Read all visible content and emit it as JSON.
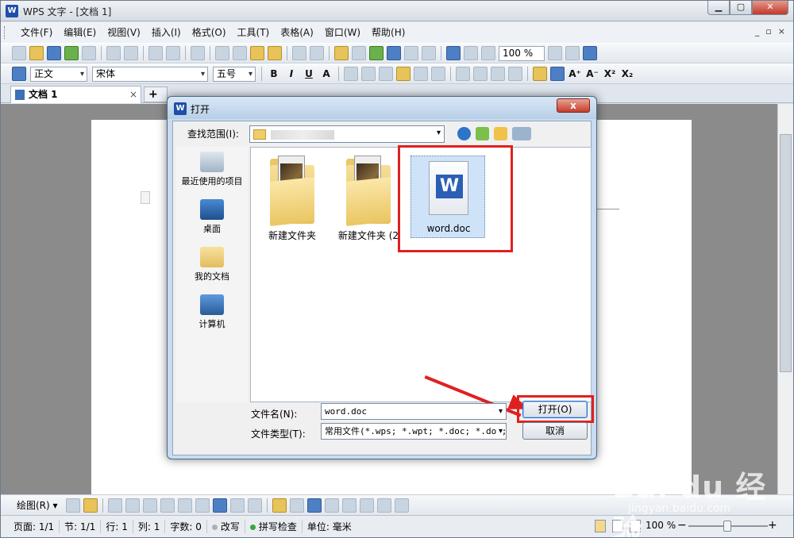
{
  "window": {
    "title": "WPS 文字 - [文档 1]",
    "app_icon": "W",
    "min_label": "▁",
    "max_label": "▢",
    "close_label": "✕"
  },
  "menubar": {
    "items": [
      "文件(F)",
      "编辑(E)",
      "视图(V)",
      "插入(I)",
      "格式(O)",
      "工具(T)",
      "表格(A)",
      "窗口(W)",
      "帮助(H)"
    ],
    "mdi": [
      "_",
      "▫",
      "×"
    ]
  },
  "toolbar": {
    "zoom": "100 %"
  },
  "format_bar": {
    "style": "正文",
    "font": "宋体",
    "size": "五号",
    "bold": "B",
    "italic": "I",
    "underline": "U",
    "font_a": "A",
    "superscript": "X²",
    "subscript": "X₂"
  },
  "tabs": {
    "doc_tab": "文档 1",
    "close": "×",
    "new": "+ ▾"
  },
  "dialog": {
    "title": "打开",
    "close_label": "x",
    "lookin_label": "查找范围(I):",
    "places": [
      "最近使用的项目",
      "桌面",
      "我的文档",
      "计算机"
    ],
    "files": [
      {
        "name": "新建文件夹",
        "type": "folder"
      },
      {
        "name": "新建文件夹 (2",
        "type": "folder"
      },
      {
        "name": "word.doc",
        "type": "doc"
      }
    ],
    "filename_label": "文件名(N):",
    "filename_value": "word.doc",
    "filetype_label": "文件类型(T):",
    "filetype_value": "常用文件(*.wps; *.wpt; *.doc; *.dot;",
    "open_button": "打开(O)",
    "cancel_button": "取消"
  },
  "drawbar": {
    "label": "绘图(R) ▾"
  },
  "status": {
    "page": "页面: 1/1",
    "section": "节: 1/1",
    "row": "行: 1",
    "col": "列: 1",
    "chars": "字数: 0",
    "overwrite": "改写",
    "spellcheck": "拼写检查",
    "unit": "单位: 毫米",
    "zoom": "100 %",
    "minus": "−",
    "plus": "+"
  },
  "watermark": {
    "brand": "Bai du 经验",
    "url": "jingyan.baidu.com"
  },
  "colors": {
    "highlight": "#e02020",
    "accent": "#2a5fb5"
  }
}
